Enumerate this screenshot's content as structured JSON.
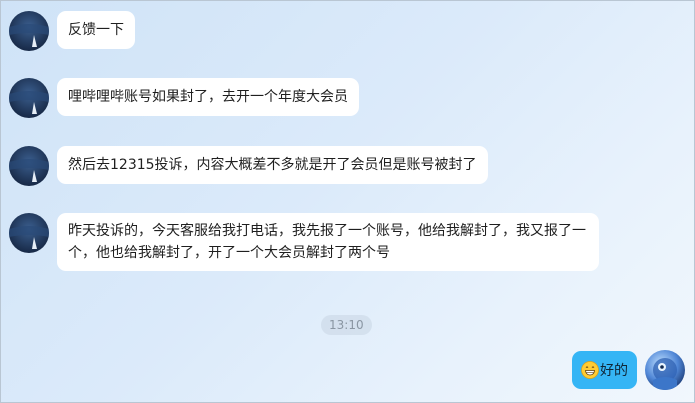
{
  "messages": [
    {
      "text": "反馈一下"
    },
    {
      "text": "哩哔哩哔账号如果封了，去开一个年度大会员"
    },
    {
      "text": "然后去12315投诉，内容大概差不多就是开了会员但是账号被封了"
    },
    {
      "text": "昨天投诉的，今天客服给我打电话，我先报了一个账号，他给我解封了，我又报了一个，他也给我解封了，开了一个大会员解封了两个号"
    }
  ],
  "timestamp": "13:10",
  "self_message": {
    "text": "好的",
    "emoji": "grinning-face-icon"
  },
  "colors": {
    "self_bubble": "#35b5f5",
    "other_bubble": "#ffffff",
    "background": "#dbeafa"
  }
}
